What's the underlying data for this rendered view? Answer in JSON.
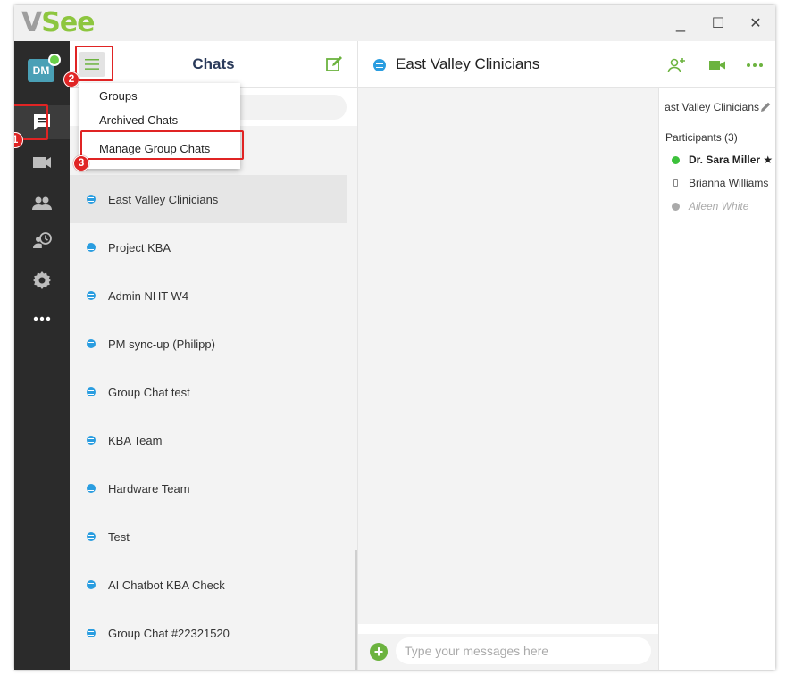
{
  "app": {
    "logo_v": "V",
    "logo_rest": "See",
    "minimize": "_",
    "maximize": "☐",
    "close": "✕"
  },
  "rail": {
    "avatar_initials": "DM",
    "items": [
      {
        "icon": "chat-icon",
        "active": true
      },
      {
        "icon": "video-icon"
      },
      {
        "icon": "contacts-icon"
      },
      {
        "icon": "history-icon"
      },
      {
        "icon": "settings-icon"
      },
      {
        "icon": "more-icon"
      }
    ]
  },
  "chats": {
    "title": "Chats",
    "menu": {
      "items": [
        "Groups",
        "Archived Chats",
        "Manage Group Chats"
      ]
    },
    "list": [
      {
        "name": "East Valley Clinicians",
        "selected": true
      },
      {
        "name": "Project KBA"
      },
      {
        "name": "Admin NHT W4"
      },
      {
        "name": "PM sync-up (Philipp)"
      },
      {
        "name": "Group Chat test"
      },
      {
        "name": "KBA Team"
      },
      {
        "name": "Hardware Team"
      },
      {
        "name": "Test"
      },
      {
        "name": "AI Chatbot KBA Check"
      },
      {
        "name": "Group Chat #22321520"
      }
    ]
  },
  "main": {
    "title": "East Valley Clinicians",
    "composer_placeholder": "Type your messages here",
    "composer_add": "+"
  },
  "panel": {
    "title": "ast Valley Clinicians",
    "participants_label": "Participants (3)",
    "participants": [
      {
        "name": "Dr. Sara Miller ★",
        "status": "online",
        "color": "#3cc13b",
        "bold": true
      },
      {
        "name": "Brianna Williams",
        "status": "mobile",
        "color": "#888888"
      },
      {
        "name": "Aileen White",
        "status": "offline",
        "color": "#aaaaaa",
        "italic": true
      }
    ]
  },
  "annotations": {
    "labels": [
      "1",
      "2",
      "3"
    ]
  },
  "colors": {
    "accent_green": "#6cb33f",
    "chat_blue": "#2a9de0",
    "annotation_red": "#e02424",
    "rail_bg": "#2b2b2b"
  }
}
